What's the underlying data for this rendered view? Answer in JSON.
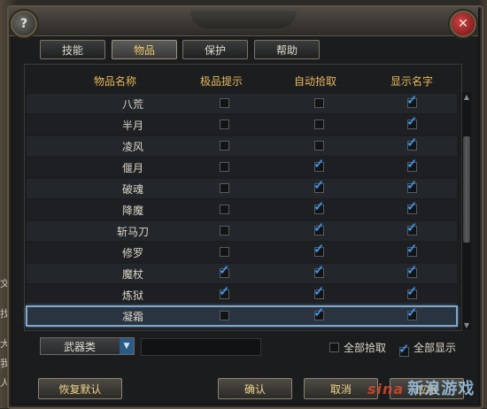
{
  "background_side_text": [
    "文",
    "找",
    "大",
    "我",
    "人"
  ],
  "tabs": [
    {
      "label": "技能",
      "active": false
    },
    {
      "label": "物品",
      "active": true
    },
    {
      "label": "保护",
      "active": false
    },
    {
      "label": "帮助",
      "active": false
    }
  ],
  "columns": {
    "name": "物品名称",
    "quality_hint": "极品提示",
    "auto_pickup": "自动拾取",
    "show_name": "显示名字"
  },
  "items": [
    {
      "name": "八荒",
      "quality_hint": false,
      "auto_pickup": false,
      "show_name": true
    },
    {
      "name": "半月",
      "quality_hint": false,
      "auto_pickup": false,
      "show_name": true
    },
    {
      "name": "凌风",
      "quality_hint": false,
      "auto_pickup": false,
      "show_name": true
    },
    {
      "name": "偃月",
      "quality_hint": false,
      "auto_pickup": true,
      "show_name": true
    },
    {
      "name": "破魂",
      "quality_hint": false,
      "auto_pickup": true,
      "show_name": true
    },
    {
      "name": "降魔",
      "quality_hint": false,
      "auto_pickup": true,
      "show_name": true
    },
    {
      "name": "斩马刀",
      "quality_hint": false,
      "auto_pickup": true,
      "show_name": true
    },
    {
      "name": "修罗",
      "quality_hint": false,
      "auto_pickup": true,
      "show_name": true
    },
    {
      "name": "魔杖",
      "quality_hint": true,
      "auto_pickup": true,
      "show_name": true
    },
    {
      "name": "炼狱",
      "quality_hint": true,
      "auto_pickup": true,
      "show_name": true
    },
    {
      "name": "凝霜",
      "quality_hint": false,
      "auto_pickup": true,
      "show_name": true,
      "selected": true
    }
  ],
  "category_select": {
    "value": "武器类"
  },
  "options": {
    "pickup_all": {
      "label": "全部拾取",
      "checked": false
    },
    "show_all": {
      "label": "全部显示",
      "checked": true
    }
  },
  "buttons": {
    "restore_defaults": "恢复默认",
    "confirm": "确认",
    "cancel": "取消",
    "apply": "应用"
  },
  "watermark": {
    "brand": "sina",
    "text": "新浪游戏"
  },
  "colors": {
    "accent_gold": "#e7b85c",
    "check_blue": "#4ea8ff",
    "selection_outline": "#7fa8cc"
  }
}
